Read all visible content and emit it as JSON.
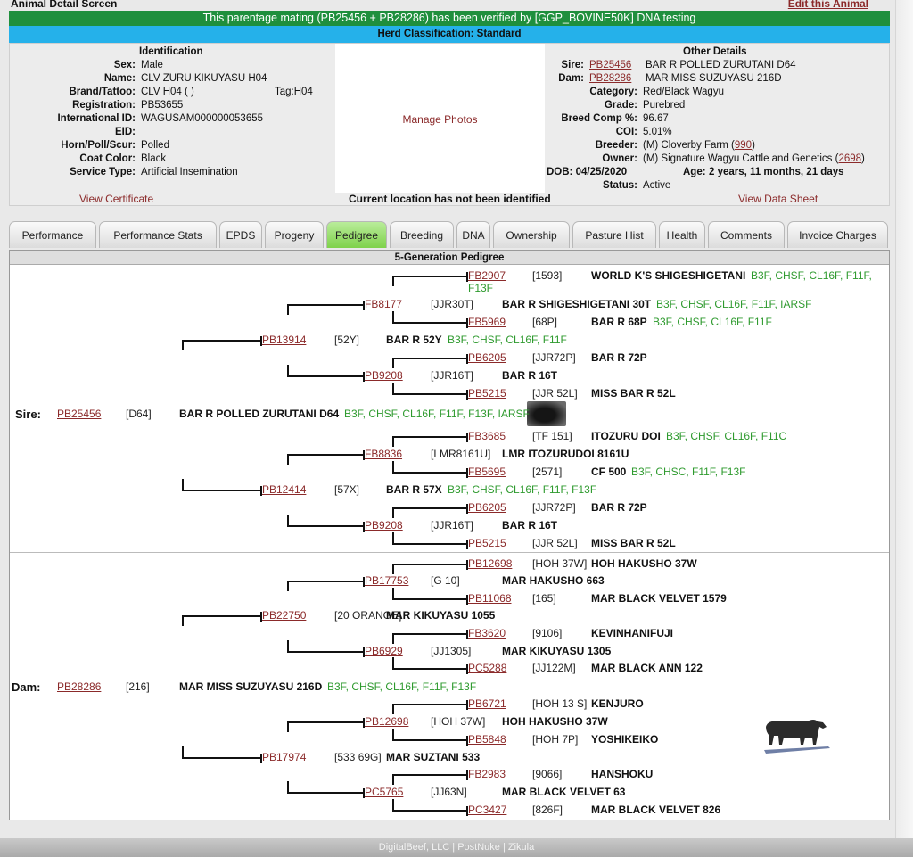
{
  "header": {
    "screen_title": "Animal Detail Screen",
    "edit_link": "Edit this Animal"
  },
  "banners": {
    "verified": "This parentage mating (PB25456 + PB28286) has been verified by [GGP_BOVINE50K] DNA testing",
    "classification": "Herd Classification: Standard"
  },
  "identification": {
    "heading": "Identification",
    "rows": [
      {
        "label": "Sex:",
        "value": "Male"
      },
      {
        "label": "Name:",
        "value": "CLV ZURU KIKUYASU H04"
      },
      {
        "label": "Brand/Tattoo:",
        "value": "CLV H04 ( )",
        "extra": "Tag:H04"
      },
      {
        "label": "Registration:",
        "value": "PB53655"
      },
      {
        "label": "International ID:",
        "value": "WAGUSAM000000053655"
      },
      {
        "label": "EID:",
        "value": ""
      },
      {
        "label": "Horn/Poll/Scur:",
        "value": "Polled"
      },
      {
        "label": "Coat Color:",
        "value": "Black"
      },
      {
        "label": "Service Type:",
        "value": "Artificial Insemination"
      }
    ],
    "view_certificate": "View Certificate"
  },
  "photos": {
    "manage": "Manage Photos",
    "location": "Current location has not been identified"
  },
  "other": {
    "heading": "Other Details",
    "sire_label": "Sire:",
    "sire_reg": "PB25456",
    "sire_name": "BAR R POLLED ZURUTANI D64",
    "dam_label": "Dam:",
    "dam_reg": "PB28286",
    "dam_name": "MAR MISS SUZUYASU 216D",
    "category_label": "Category:",
    "category": "Red/Black Wagyu",
    "grade_label": "Grade:",
    "grade": "Purebred",
    "breedcomp_label": "Breed Comp %:",
    "breedcomp": "96.67",
    "coi_label": "COI:",
    "coi": "5.01%",
    "breeder_label": "Breeder:",
    "breeder": "(M) Cloverby Farm (",
    "breeder_code": "990",
    "breeder_close": ")",
    "owner_label": "Owner:",
    "owner": "(M) Signature Wagyu Cattle and Genetics (",
    "owner_code": "2698",
    "owner_close": ")",
    "dob": "DOB: 04/25/2020",
    "age_label": "Age:",
    "age": "2 years, 11 months, 21 days",
    "status_label": "Status:",
    "status": "Active",
    "view_data_sheet": "View Data Sheet"
  },
  "tabs": [
    "Performance",
    "Performance Stats",
    "EPDS",
    "Progeny",
    "Pedigree",
    "Breeding",
    "DNA",
    "Ownership",
    "Pasture Hist",
    "Health",
    "Comments",
    "Invoice Charges"
  ],
  "active_tab": "Pedigree",
  "pedigree": {
    "title": "5-Generation Pedigree",
    "sire_label": "Sire:",
    "dam_label": "Dam:",
    "nodes": [
      {
        "reg": "FB2907",
        "tag": "[1593]",
        "name": "WORLD K'S SHIGESHIGETANI",
        "traits": "B3F, CHSF, CL16F, F11F,",
        "traits2": "F13F"
      },
      {
        "reg": "FB8177",
        "tag": "[JJR30T]",
        "name": "BAR R SHIGESHIGETANI 30T",
        "traits": "B3F, CHSF, CL16F, F11F, IARSF"
      },
      {
        "reg": "FB5969",
        "tag": "[68P]",
        "name": "BAR R 68P",
        "traits": "B3F, CHSF, CL16F, F11F"
      },
      {
        "reg": "PB13914",
        "tag": "[52Y]",
        "name": "BAR R 52Y",
        "traits": "B3F, CHSF, CL16F, F11F"
      },
      {
        "reg": "PB6205",
        "tag": "[JJR72P]",
        "name": "BAR R 72P",
        "traits": ""
      },
      {
        "reg": "PB9208",
        "tag": "[JJR16T]",
        "name": "BAR R 16T",
        "traits": ""
      },
      {
        "reg": "PB5215",
        "tag": "[JJR 52L]",
        "name": "MISS BAR R 52L",
        "traits": ""
      },
      {
        "reg": "PB25456",
        "tag": "[D64]",
        "name": "BAR R POLLED ZURUTANI D64",
        "traits": "B3F, CHSF, CL16F, F11F, F13F, IARSF"
      },
      {
        "reg": "FB3685",
        "tag": "[TF 151]",
        "name": "ITOZURU DOI",
        "traits": "B3F, CHSF, CL16F, F11C"
      },
      {
        "reg": "FB8836",
        "tag": "[LMR8161U]",
        "name": "LMR ITOZURUDOI 8161U",
        "traits": ""
      },
      {
        "reg": "FB5695",
        "tag": "[2571]",
        "name": "CF 500",
        "traits": "B3F, CHSC, F11F, F13F"
      },
      {
        "reg": "PB12414",
        "tag": "[57X]",
        "name": "BAR R 57X",
        "traits": "B3F, CHSF, CL16F, F11F, F13F"
      },
      {
        "reg": "PB6205",
        "tag": "[JJR72P]",
        "name": "BAR R 72P",
        "traits": ""
      },
      {
        "reg": "PB9208",
        "tag": "[JJR16T]",
        "name": "BAR R 16T",
        "traits": ""
      },
      {
        "reg": "PB5215",
        "tag": "[JJR 52L]",
        "name": "MISS BAR R 52L",
        "traits": ""
      },
      {
        "reg": "PB12698",
        "tag": "[HOH 37W]",
        "name": "HOH HAKUSHO 37W",
        "traits": ""
      },
      {
        "reg": "PB17753",
        "tag": "[G 10]",
        "name": "MAR HAKUSHO 663",
        "traits": ""
      },
      {
        "reg": "PB11068",
        "tag": "[165]",
        "name": "MAR BLACK VELVET 1579",
        "traits": ""
      },
      {
        "reg": "PB22750",
        "tag": "[20 ORANGE]",
        "name": "MAR KIKUYASU 1055",
        "traits": ""
      },
      {
        "reg": "FB3620",
        "tag": "[9106]",
        "name": "KEVINHANIFUJI",
        "traits": ""
      },
      {
        "reg": "PB6929",
        "tag": "[JJ1305]",
        "name": "MAR KIKUYASU 1305",
        "traits": ""
      },
      {
        "reg": "PC5288",
        "tag": "[JJ122M]",
        "name": "MAR BLACK ANN 122",
        "traits": ""
      },
      {
        "reg": "PB28286",
        "tag": "[216]",
        "name": "MAR MISS SUZUYASU 216D",
        "traits": "B3F, CHSF, CL16F, F11F, F13F"
      },
      {
        "reg": "PB6721",
        "tag": "[HOH 13 S]",
        "name": "KENJURO",
        "traits": ""
      },
      {
        "reg": "PB12698",
        "tag": "[HOH 37W]",
        "name": "HOH HAKUSHO 37W",
        "traits": ""
      },
      {
        "reg": "PB5848",
        "tag": "[HOH 7P]",
        "name": "YOSHIKEIKO",
        "traits": ""
      },
      {
        "reg": "PB17974",
        "tag": "[533 69G]",
        "name": "MAR SUZTANI 533",
        "traits": ""
      },
      {
        "reg": "FB2983",
        "tag": "[9066]",
        "name": "HANSHOKU",
        "traits": ""
      },
      {
        "reg": "PC5765",
        "tag": "[JJ63N]",
        "name": "MAR BLACK VELVET 63",
        "traits": ""
      },
      {
        "reg": "PC3427",
        "tag": "[826F]",
        "name": "MAR BLACK VELVET 826",
        "traits": ""
      }
    ]
  },
  "footer": "DigitalBeef, LLC | PostNuke | Zikula"
}
